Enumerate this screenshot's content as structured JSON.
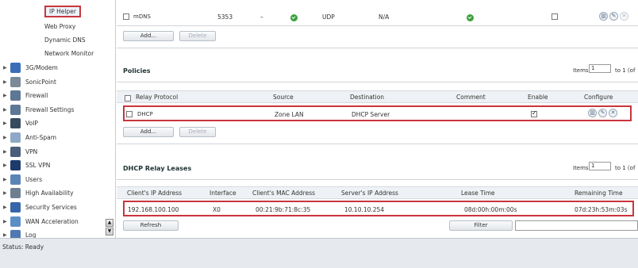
{
  "sidebar": {
    "sub_items": [
      {
        "label": "IP Helper",
        "selected": true
      },
      {
        "label": "Web Proxy",
        "selected": false
      },
      {
        "label": "Dynamic DNS",
        "selected": false
      },
      {
        "label": "Network Monitor",
        "selected": false
      }
    ],
    "items": [
      {
        "label": "3G/Modem",
        "icon": "modem-icon",
        "color": "#3a6fb8"
      },
      {
        "label": "SonicPoint",
        "icon": "access-point-icon",
        "color": "#7b8a99"
      },
      {
        "label": "Firewall",
        "icon": "firewall-icon",
        "color": "#5d7894"
      },
      {
        "label": "Firewall Settings",
        "icon": "firewall-settings-icon",
        "color": "#5d7894"
      },
      {
        "label": "VoIP",
        "icon": "phone-icon",
        "color": "#384a5e"
      },
      {
        "label": "Anti-Spam",
        "icon": "mail-icon",
        "color": "#8fa8c7"
      },
      {
        "label": "VPN",
        "icon": "vpn-icon",
        "color": "#4b5e7a"
      },
      {
        "label": "SSL VPN",
        "icon": "ssl-vpn-icon",
        "color": "#1e3a6b"
      },
      {
        "label": "Users",
        "icon": "users-icon",
        "color": "#5a84b5"
      },
      {
        "label": "High Availability",
        "icon": "ha-icon",
        "color": "#6e7f92"
      },
      {
        "label": "Security Services",
        "icon": "shield-icon",
        "color": "#3766a8"
      },
      {
        "label": "WAN Acceleration",
        "icon": "wan-icon",
        "color": "#5c8fc8"
      },
      {
        "label": "Log",
        "icon": "log-icon",
        "color": "#4f79b1"
      }
    ]
  },
  "top_row": {
    "name": "mDNS",
    "port": "5353",
    "dash": "–",
    "protocol": "UDP",
    "na": "N/A"
  },
  "buttons": {
    "add": "Add...",
    "delete": "Delete",
    "refresh": "Refresh",
    "filter": "Filter"
  },
  "policies": {
    "title": "Policies",
    "items_label": "Items",
    "items_value": "1",
    "items_to": "to 1 (of",
    "columns": [
      "Relay Protocol",
      "Source",
      "Destination",
      "Comment",
      "Enable",
      "Configure"
    ],
    "row": {
      "protocol": "DHCP",
      "source": "Zone LAN",
      "destination": "DHCP Server",
      "comment": "",
      "enabled": true
    }
  },
  "leases": {
    "title": "DHCP Relay Leases",
    "items_label": "Items",
    "items_value": "1",
    "items_to": "to 1 (of",
    "columns": [
      "Client's IP Address",
      "Interface",
      "Client's MAC Address",
      "Server's IP Address",
      "Lease Time",
      "Remaining Time"
    ],
    "row": {
      "client_ip": "192.168.100.100",
      "interface": "X0",
      "mac": "00:21:9b:71:8c:35",
      "server_ip": "10.10.10.254",
      "lease": "08d:00h:00m:00s",
      "remaining": "07d:23h:53m:03s"
    }
  },
  "status": {
    "text": "Status: Ready"
  }
}
